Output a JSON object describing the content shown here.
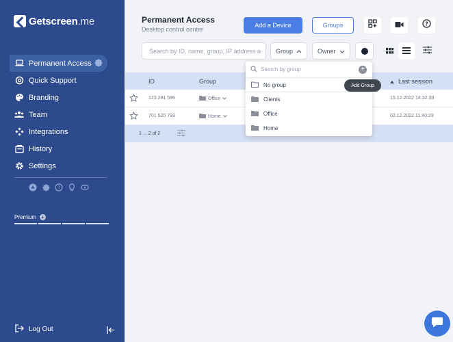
{
  "brand": {
    "name": "Getscreen",
    "suffix": ".me"
  },
  "sidebar": {
    "items": [
      {
        "label": "Permanent Access",
        "icon": "laptop-icon",
        "active": true
      },
      {
        "label": "Quick Support",
        "icon": "lifebuoy-icon"
      },
      {
        "label": "Branding",
        "icon": "palette-icon"
      },
      {
        "label": "Team",
        "icon": "team-icon"
      },
      {
        "label": "Integrations",
        "icon": "integrations-icon"
      },
      {
        "label": "History",
        "icon": "history-icon"
      },
      {
        "label": "Settings",
        "icon": "gear-icon"
      }
    ],
    "tools": [
      "bug-icon",
      "puzzle-icon",
      "help-icon",
      "bulb-icon",
      "gamepad-icon"
    ],
    "premium": "Premium",
    "logout": "Log Out"
  },
  "header": {
    "title": "Permanent Access",
    "subtitle": "Desktop control center",
    "add_device": "Add a Device",
    "groups": "Groups"
  },
  "filters": {
    "search_placeholder": "Search by ID, name, group, IP address a",
    "group": "Group",
    "owner": "Owner"
  },
  "table": {
    "columns": {
      "id": "ID",
      "group": "Group",
      "last_session": "Last session"
    },
    "rows": [
      {
        "id": "123 291 595",
        "group": "Office",
        "last": "15.12.2022 14:32:38"
      },
      {
        "id": "701 520 793",
        "group": "Home",
        "last": "02.12.2022 11:40:29"
      }
    ],
    "pagination": "1 ... 2 of 2"
  },
  "group_popup": {
    "placeholder": "Search by group",
    "items": [
      "No group",
      "Clients",
      "Office",
      "Home"
    ],
    "tooltip": "Add Group"
  },
  "colors": {
    "sidebar": "#2c4a8c",
    "accent": "#4a7de6",
    "table_head": "#d6e0f4"
  }
}
